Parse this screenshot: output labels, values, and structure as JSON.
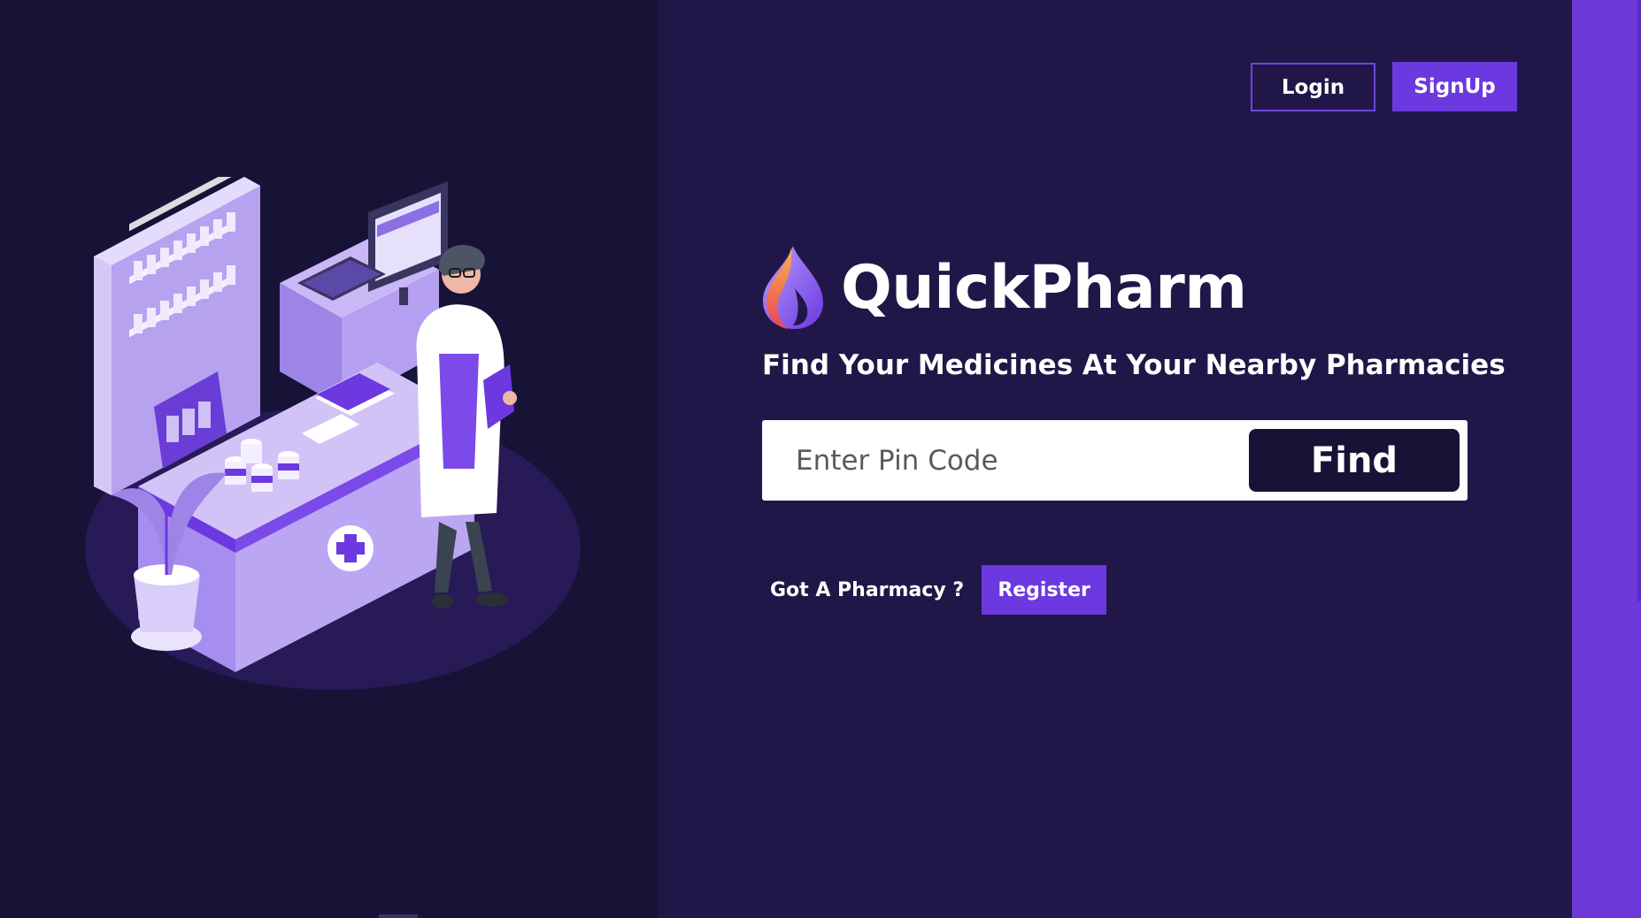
{
  "header": {
    "login_label": "Login",
    "signup_label": "SignUp"
  },
  "brand": {
    "name": "QuickPharm",
    "logo_icon": "flame-drop-icon"
  },
  "hero": {
    "tagline": "Find Your Medicines At Your Nearby Pharmacies"
  },
  "search": {
    "placeholder": "Enter Pin Code",
    "value": "",
    "find_label": "Find"
  },
  "register": {
    "prompt": "Got A Pharmacy ?",
    "button_label": "Register"
  },
  "illustration": {
    "subject": "pharmacist-at-counter-illustration"
  },
  "colors": {
    "left_bg": "#161336",
    "right_bg": "#201748",
    "accent": "#6c38e0",
    "rail": "#6c38d8",
    "find_button": "#161336"
  }
}
